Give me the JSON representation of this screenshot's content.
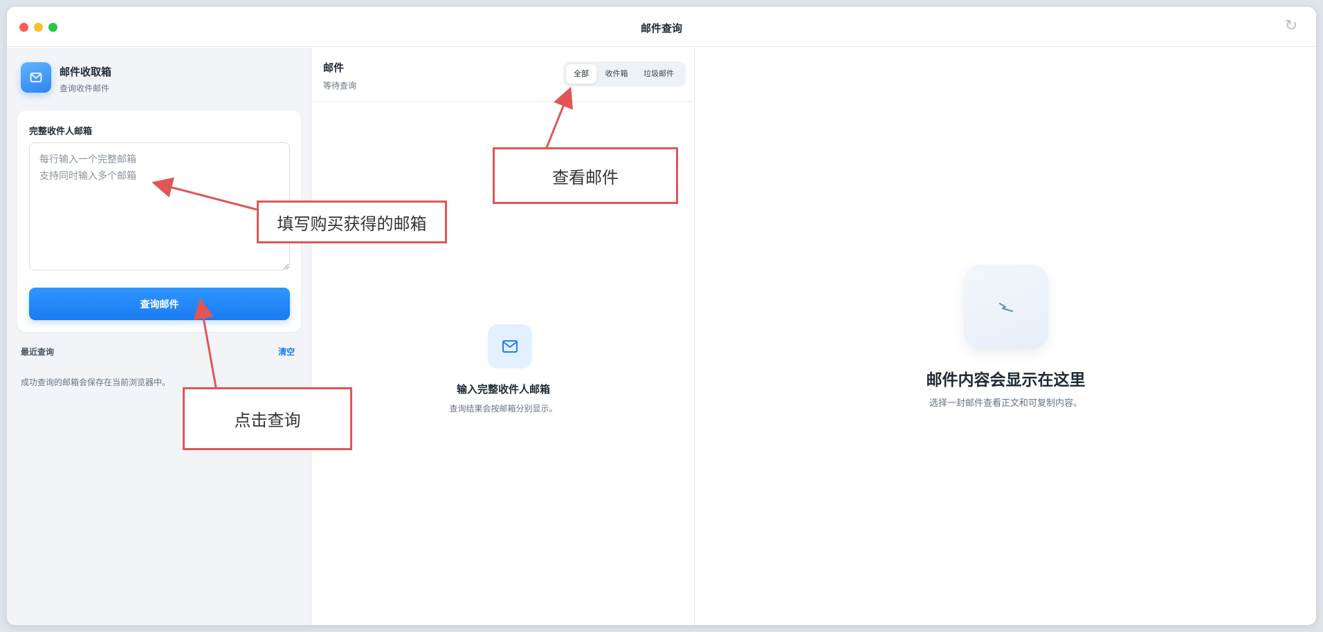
{
  "window": {
    "title": "邮件查询",
    "refresh_icon": "refresh-icon"
  },
  "sidebar": {
    "brand_title": "邮件收取箱",
    "brand_subtitle": "查询收件邮件",
    "field_label": "完整收件人邮箱",
    "input_placeholder": "每行输入一个完整邮箱\n支持同时输入多个邮箱",
    "input_value": "",
    "query_button_label": "查询邮件",
    "recent_label": "最近查询",
    "clear_label": "清空",
    "recent_note": "成功查询的邮箱会保存在当前浏览器中。"
  },
  "mail_panel": {
    "title": "邮件",
    "status": "等待查询",
    "tabs": [
      {
        "label": "全部",
        "active": true
      },
      {
        "label": "收件箱",
        "active": false
      },
      {
        "label": "垃圾邮件",
        "active": false
      }
    ],
    "empty_title": "输入完整收件人邮箱",
    "empty_subtitle": "查询结果会按邮箱分别显示。"
  },
  "content_panel": {
    "empty_title": "邮件内容会显示在这里",
    "empty_subtitle": "选择一封邮件查看正文和可复制内容。"
  },
  "annotations": {
    "fill_email": "填写购买获得的邮箱",
    "view_mail": "查看邮件",
    "click_query": "点击查询",
    "color": "#e05555"
  },
  "colors": {
    "accent": "#1a7cf2",
    "traffic_red": "#ff5f57",
    "traffic_yellow": "#febc2e",
    "traffic_green": "#28c840"
  }
}
